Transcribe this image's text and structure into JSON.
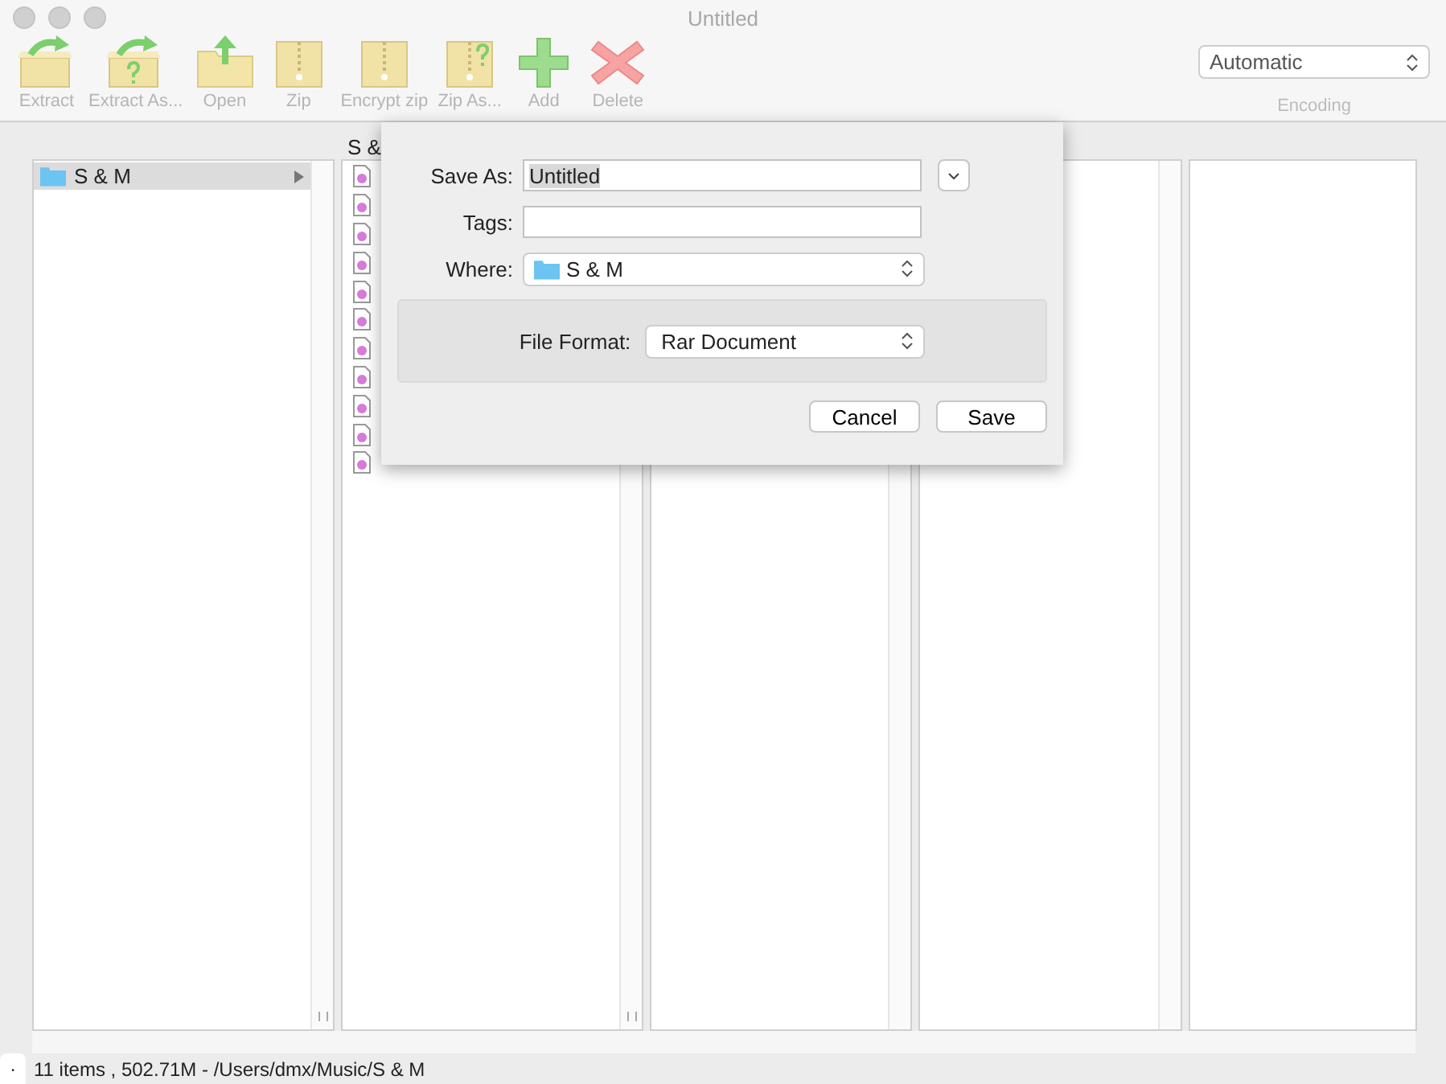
{
  "window": {
    "title": "Untitled"
  },
  "toolbar": {
    "buttons": [
      {
        "label": "Extract",
        "kind": "extract"
      },
      {
        "label": "Extract As...",
        "kind": "extract-as"
      },
      {
        "label": "Open",
        "kind": "open"
      },
      {
        "label": "Zip",
        "kind": "zip"
      },
      {
        "label": "Encrypt zip",
        "kind": "zip"
      },
      {
        "label": "Zip As...",
        "kind": "zip-as"
      },
      {
        "label": "Add",
        "kind": "add"
      },
      {
        "label": "Delete",
        "kind": "delete"
      }
    ],
    "encoding": {
      "value": "Automatic",
      "label": "Encoding"
    }
  },
  "browser": {
    "column_header": "S &",
    "folders": [
      {
        "name": "S & M",
        "selected": true
      }
    ],
    "files": [
      {
        "kind": "audio"
      },
      {
        "kind": "audio"
      },
      {
        "kind": "audio"
      },
      {
        "kind": "audio"
      },
      {
        "kind": "audio"
      },
      {
        "kind": "audio"
      },
      {
        "kind": "audio"
      },
      {
        "kind": "audio"
      },
      {
        "kind": "audio"
      },
      {
        "kind": "audio"
      },
      {
        "kind": "audio"
      }
    ]
  },
  "dialog": {
    "save_as_label": "Save As:",
    "save_as_value": "Untitled",
    "tags_label": "Tags:",
    "where_label": "Where:",
    "where_value": "S & M",
    "format_label": "File Format:",
    "format_value": "Rar Document",
    "buttons": [
      "Cancel",
      "Save"
    ]
  },
  "status_bar": {
    "tab": ".",
    "text": "11 items , 502.71M - /Users/dmx/Music/S & M"
  }
}
